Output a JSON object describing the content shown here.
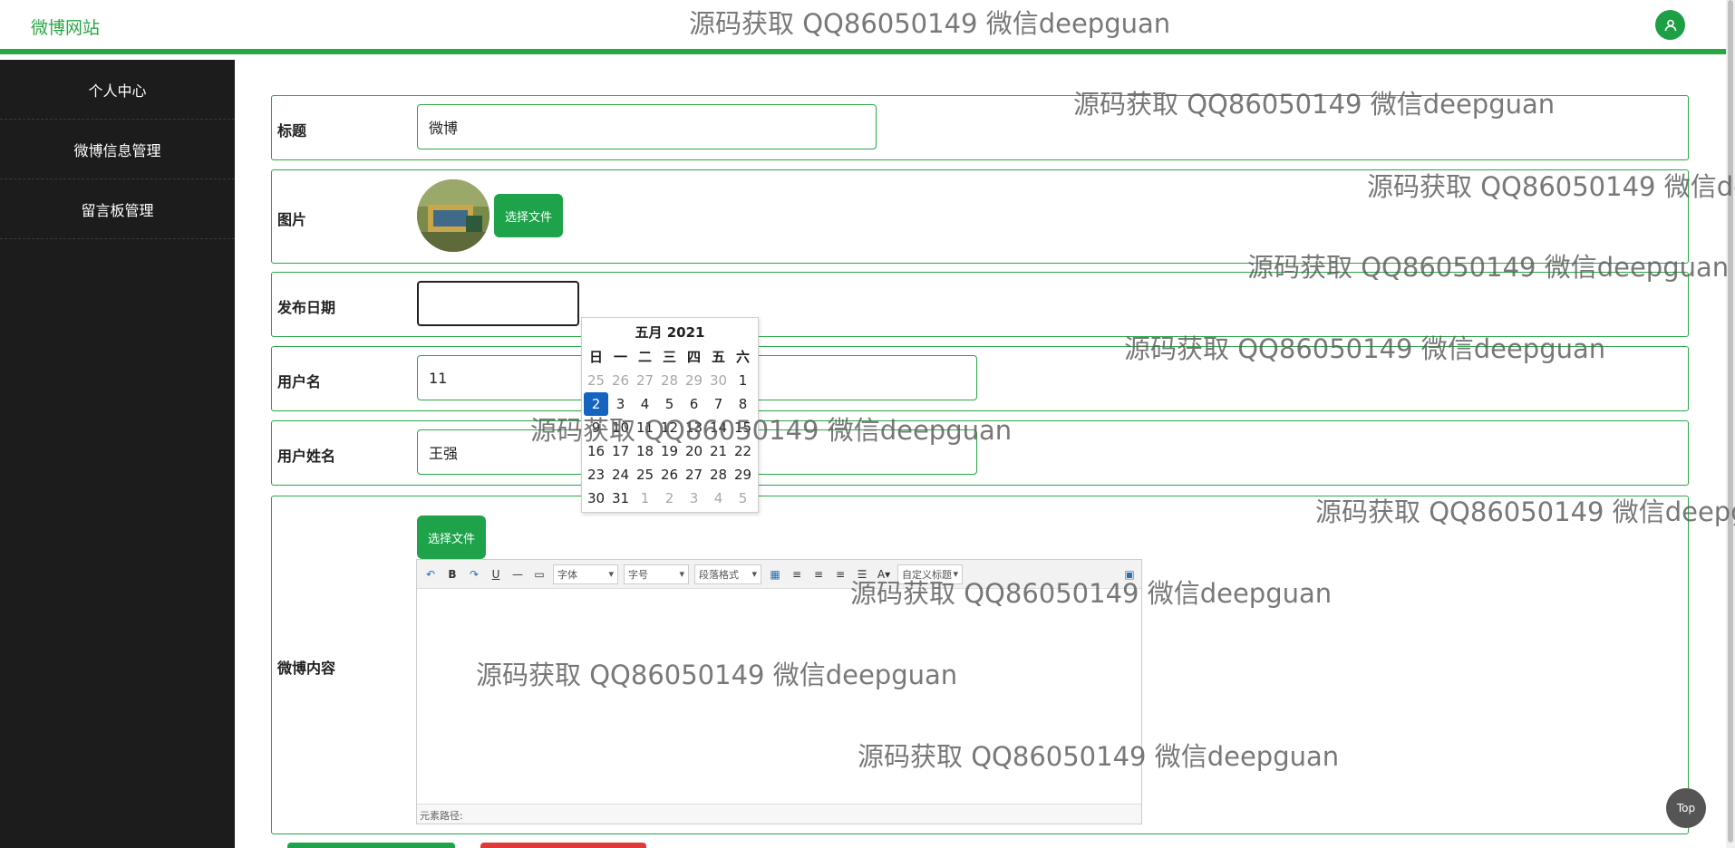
{
  "header": {
    "brand": "微博网站",
    "watermark": "源码获取 QQ86050149 微信deepguan"
  },
  "sidebar": {
    "items": [
      "个人中心",
      "微博信息管理",
      "留言板管理"
    ]
  },
  "form": {
    "title_label": "标题",
    "title_value": "微博",
    "image_label": "图片",
    "image_button": "选择文件",
    "date_label": "发布日期",
    "date_value": "",
    "username_label": "用户名",
    "username_value": "11",
    "realname_label": "用户姓名",
    "realname_value": "王强",
    "content_label": "微博内容",
    "content_button": "选择文件"
  },
  "calendar": {
    "title": "五月 2021",
    "weekdays": [
      "日",
      "一",
      "二",
      "三",
      "四",
      "五",
      "六"
    ],
    "days": [
      [
        "25",
        "other"
      ],
      [
        "26",
        "other"
      ],
      [
        "27",
        "other"
      ],
      [
        "28",
        "other"
      ],
      [
        "29",
        "other"
      ],
      [
        "30",
        "other"
      ],
      [
        "1",
        ""
      ],
      [
        "2",
        "today"
      ],
      [
        "3",
        ""
      ],
      [
        "4",
        ""
      ],
      [
        "5",
        ""
      ],
      [
        "6",
        ""
      ],
      [
        "7",
        ""
      ],
      [
        "8",
        ""
      ],
      [
        "9",
        ""
      ],
      [
        "10",
        ""
      ],
      [
        "11",
        ""
      ],
      [
        "12",
        ""
      ],
      [
        "13",
        ""
      ],
      [
        "14",
        ""
      ],
      [
        "15",
        ""
      ],
      [
        "16",
        ""
      ],
      [
        "17",
        ""
      ],
      [
        "18",
        ""
      ],
      [
        "19",
        ""
      ],
      [
        "20",
        ""
      ],
      [
        "21",
        ""
      ],
      [
        "22",
        ""
      ],
      [
        "23",
        ""
      ],
      [
        "24",
        ""
      ],
      [
        "25",
        ""
      ],
      [
        "26",
        ""
      ],
      [
        "27",
        ""
      ],
      [
        "28",
        ""
      ],
      [
        "29",
        ""
      ],
      [
        "30",
        ""
      ],
      [
        "31",
        ""
      ],
      [
        "1",
        "other"
      ],
      [
        "2",
        "other"
      ],
      [
        "3",
        "other"
      ],
      [
        "4",
        "other"
      ],
      [
        "5",
        "other"
      ]
    ]
  },
  "editor": {
    "font_select": "字体",
    "size_select": "字号",
    "paragraph_select": "段落格式",
    "custom_title_select": "自定义标题",
    "footer": "元素路径:"
  },
  "watermark_text": "源码获取 QQ86050149 微信deepguan",
  "top_button": "Top",
  "colors": {
    "accent": "#28a745",
    "sidebar": "#1c1c1c",
    "today": "#1565c0"
  }
}
